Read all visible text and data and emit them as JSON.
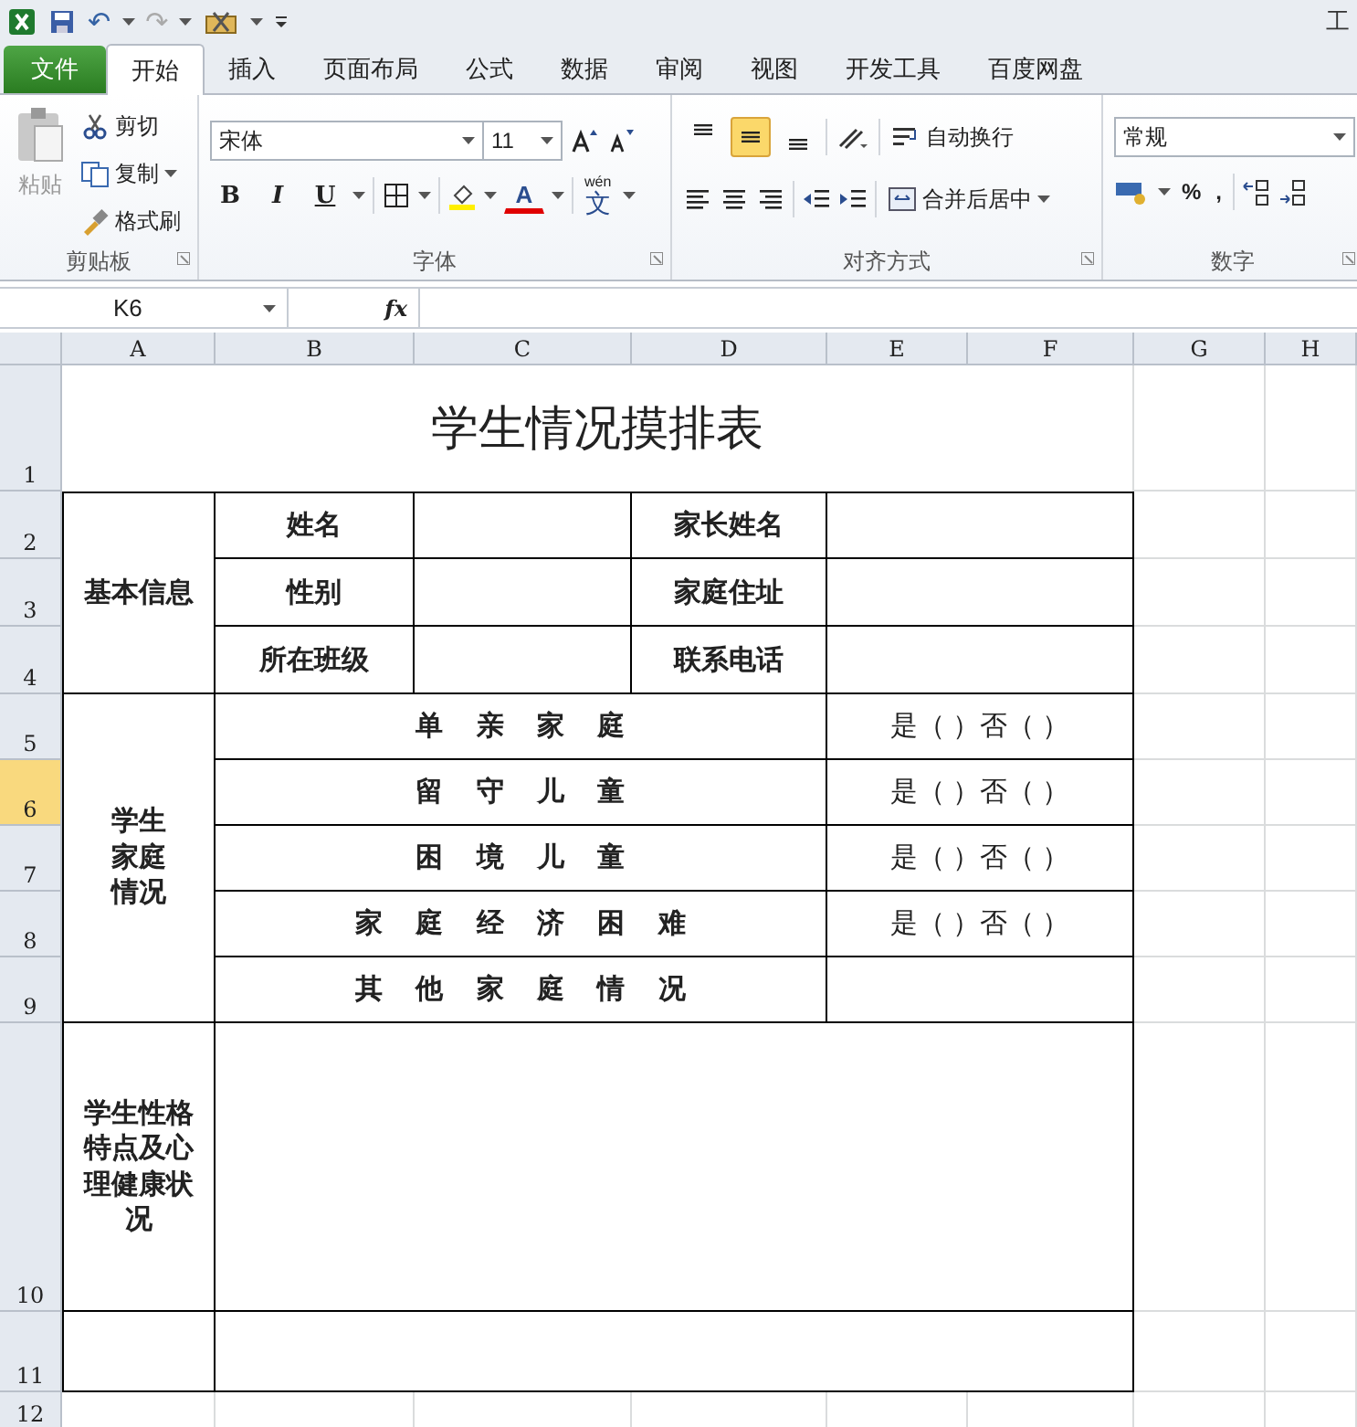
{
  "window": {
    "title": "工"
  },
  "quick_access": {
    "undo": "↶",
    "redo": "↷"
  },
  "tabs": [
    {
      "label": "文件",
      "kind": "file",
      "selected": false
    },
    {
      "label": "开始",
      "kind": "tab",
      "selected": true
    },
    {
      "label": "插入",
      "kind": "tab",
      "selected": false
    },
    {
      "label": "页面布局",
      "kind": "tab",
      "selected": false
    },
    {
      "label": "公式",
      "kind": "tab",
      "selected": false
    },
    {
      "label": "数据",
      "kind": "tab",
      "selected": false
    },
    {
      "label": "审阅",
      "kind": "tab",
      "selected": false
    },
    {
      "label": "视图",
      "kind": "tab",
      "selected": false
    },
    {
      "label": "开发工具",
      "kind": "tab",
      "selected": false
    },
    {
      "label": "百度网盘",
      "kind": "tab",
      "selected": false
    }
  ],
  "clipboard": {
    "label": "剪贴板",
    "paste": {
      "label": "粘贴",
      "disabled": true
    },
    "cut": "剪切",
    "copy": "复制",
    "format_painter": "格式刷"
  },
  "font": {
    "label": "字体",
    "name": "宋体",
    "size": "11",
    "bold": "B",
    "italic": "I",
    "underline": "U",
    "font_color": "A",
    "phonetic_top": "wén",
    "phonetic": "文"
  },
  "alignment": {
    "label": "对齐方式",
    "vertical": [
      {
        "kind": "top",
        "selected": false
      },
      {
        "kind": "middle",
        "selected": true
      },
      {
        "kind": "bottom",
        "selected": false
      }
    ],
    "wrap_text": "自动换行",
    "merge_center": "合并后居中"
  },
  "number": {
    "label": "数字",
    "format": "常规",
    "percent": "%",
    "comma": ","
  },
  "formula_bar": {
    "name_box": "K6",
    "fx": "fx"
  },
  "columns": [
    {
      "label": "A",
      "selected": false
    },
    {
      "label": "B",
      "selected": false
    },
    {
      "label": "C",
      "selected": false
    },
    {
      "label": "D",
      "selected": false
    },
    {
      "label": "E",
      "selected": false
    },
    {
      "label": "F",
      "selected": false
    },
    {
      "label": "G",
      "selected": false
    },
    {
      "label": "H",
      "selected": false
    }
  ],
  "rows": [
    {
      "label": "1",
      "selected": false
    },
    {
      "label": "2",
      "selected": false
    },
    {
      "label": "3",
      "selected": false
    },
    {
      "label": "4",
      "selected": false
    },
    {
      "label": "5",
      "selected": false
    },
    {
      "label": "6",
      "selected": true
    },
    {
      "label": "7",
      "selected": false
    },
    {
      "label": "8",
      "selected": false
    },
    {
      "label": "9",
      "selected": false
    },
    {
      "label": "10",
      "selected": false
    },
    {
      "label": "11",
      "selected": false
    },
    {
      "label": "12",
      "selected": false
    }
  ],
  "sheet": {
    "title": "学生情况摸排表",
    "cells": [
      "基本信息",
      "姓名",
      "家长姓名",
      "性别",
      "家庭住址",
      "所在班级",
      "联系电话",
      "学生家庭情况",
      "单 亲 家 庭",
      "是（ ）否（ ）",
      "留 守 儿 童",
      "是（ ）否（ ）",
      "困 境 儿 童",
      "是（ ）否（ ）",
      "家 庭 经 济 困 难",
      "是（ ）否（ ）",
      "其 他 家 庭 情 况",
      "学生性格特点及心理健康状况"
    ]
  }
}
